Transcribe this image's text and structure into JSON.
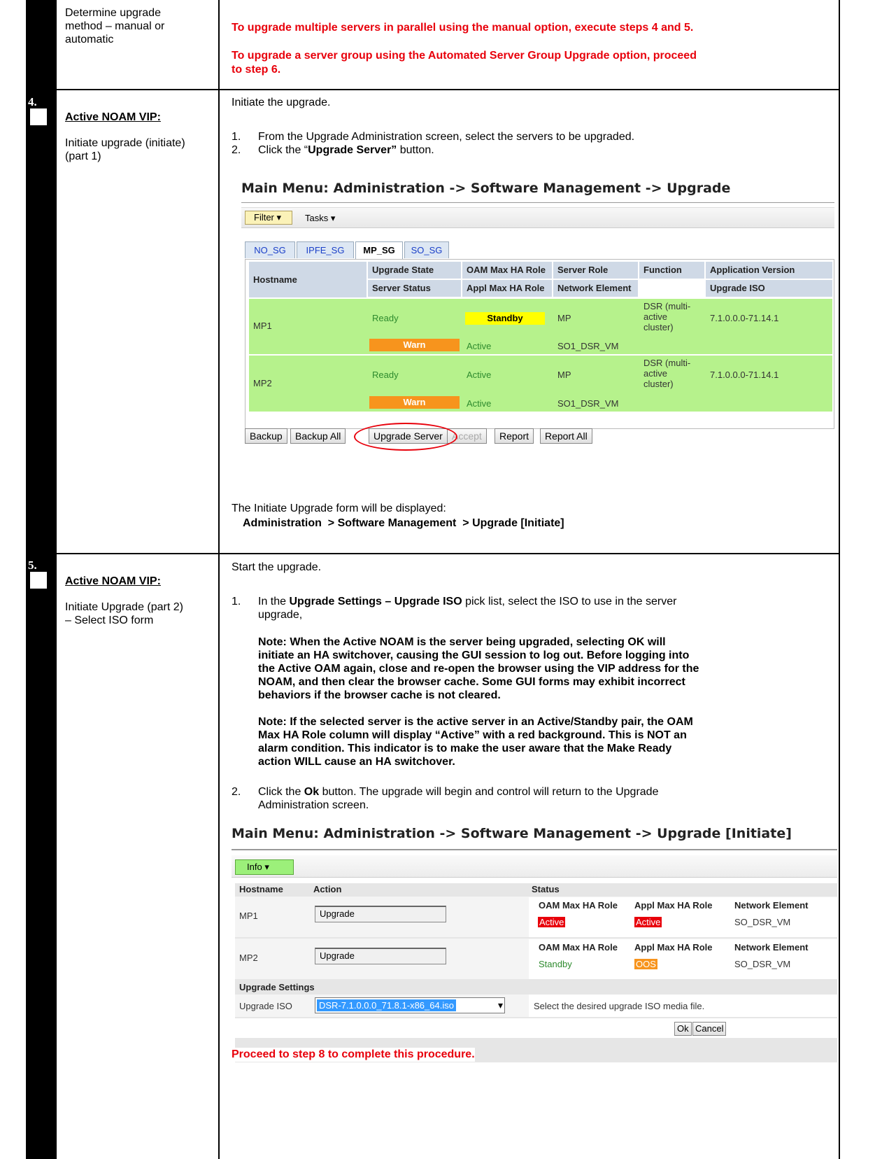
{
  "row_method": {
    "label_lines": [
      "Determine upgrade",
      "method – manual or",
      "automatic"
    ],
    "instr1": "To upgrade multiple servers in parallel using the manual option, execute steps 4 and 5.",
    "instr2_line1": "To upgrade a server group using the Automated Server Group Upgrade option, proceed",
    "instr2_line2": "to step 6."
  },
  "step4": {
    "number": "4.",
    "role": "Active NOAM VIP:",
    "desc_lines": [
      "Initiate upgrade (initiate)",
      "(part 1)"
    ],
    "intro": "Initiate the upgrade.",
    "item1_num": "1.",
    "item1": "From the Upgrade Administration screen, select the servers to be upgraded.",
    "item2_num": "2.",
    "item2_pre": "Click the “",
    "item2_bold": "Upgrade Server”",
    "item2_post": " button.",
    "screen": {
      "title": "Main Menu: Administration -> Software Management -> Upgrade",
      "filter": "Filter",
      "tasks": "Tasks",
      "tabs": [
        "NO_SG",
        "IPFE_SG",
        "MP_SG",
        "SO_SG"
      ],
      "headers": {
        "hostname": "Hostname",
        "upgrade_state": "Upgrade State",
        "oam_role": "OAM Max HA Role",
        "server_role": "Server Role",
        "function": "Function",
        "app_version": "Application Version",
        "server_status": "Server Status",
        "appl_role": "Appl Max HA Role",
        "network_element": "Network Element",
        "upgrade_iso": "Upgrade ISO"
      },
      "rows": [
        {
          "host": "MP1",
          "state": "Ready",
          "oam": "Standby",
          "role": "MP",
          "function": [
            "DSR (multi-",
            "active",
            "cluster)"
          ],
          "version": "7.1.0.0.0-71.14.1",
          "status": "Warn",
          "appl": "Active",
          "ne": "SO1_DSR_VM"
        },
        {
          "host": "MP2",
          "state": "Ready",
          "oam": "Active",
          "role": "MP",
          "function": [
            "DSR (multi-",
            "active",
            "cluster)"
          ],
          "version": "7.1.0.0.0-71.14.1",
          "status": "Warn",
          "appl": "Active",
          "ne": "SO1_DSR_VM"
        }
      ],
      "buttons": [
        "Backup",
        "Backup All",
        "Upgrade Server",
        "Accept",
        "Report",
        "Report All"
      ]
    },
    "after": "The Initiate Upgrade form will be displayed:",
    "path": "Administration  > Software Management  > Upgrade [Initiate]"
  },
  "step5": {
    "number": "5.",
    "role": "Active NOAM VIP:",
    "desc_lines": [
      "Initiate Upgrade (part 2)",
      "– Select ISO form"
    ],
    "intro": "Start the upgrade.",
    "item1_num": "1.",
    "item1_pre": "In the ",
    "item1_bold": "Upgrade Settings – Upgrade ISO",
    "item1_post": " pick list, select the ISO to use in the server",
    "item1_line2": "upgrade,",
    "note1": [
      "Note: When the Active NOAM is the server being upgraded, selecting OK will",
      "initiate an HA switchover, causing the GUI session to log out. Before logging into",
      "the Active OAM again, close and re-open the browser using the VIP address for the",
      "NOAM, and then clear the browser cache. Some GUI forms may exhibit incorrect",
      "behaviors if the browser cache is not cleared."
    ],
    "note2": [
      "Note: If the selected server is the active server in an Active/Standby pair, the OAM",
      "Max HA Role column will display “Active” with a red background. This is NOT an",
      "alarm condition. This indicator is to make the user aware that the Make Ready",
      "action WILL cause an HA switchover."
    ],
    "item2_num": "2.",
    "item2_pre": "Click the ",
    "item2_bold": "Ok",
    "item2_post": " button. The upgrade will begin and control will return to the Upgrade",
    "item2_line2": "Administration screen.",
    "screen": {
      "title": "Main Menu: Administration -> Software Management -> Upgrade [Initiate]",
      "info": "Info",
      "headers": {
        "hostname": "Hostname",
        "action": "Action",
        "status": "Status",
        "oam": "OAM Max HA Role",
        "appl": "Appl Max HA Role",
        "ne": "Network Element"
      },
      "rows": [
        {
          "host": "MP1",
          "action": "Upgrade",
          "oam": "Active",
          "appl": "Active",
          "ne": "SO_DSR_VM"
        },
        {
          "host": "MP2",
          "action": "Upgrade",
          "oam": "Standby",
          "appl": "OOS",
          "ne": "SO_DSR_VM"
        }
      ],
      "settings_label": "Upgrade Settings",
      "iso_label": "Upgrade ISO",
      "iso_value": "DSR-7.1.0.0.0_71.8.1-x86_64.iso",
      "iso_hint": "Select the desired upgrade ISO media file.",
      "ok": "Ok",
      "cancel": "Cancel"
    },
    "proceed": "Proceed to step 8 to complete this procedure."
  }
}
